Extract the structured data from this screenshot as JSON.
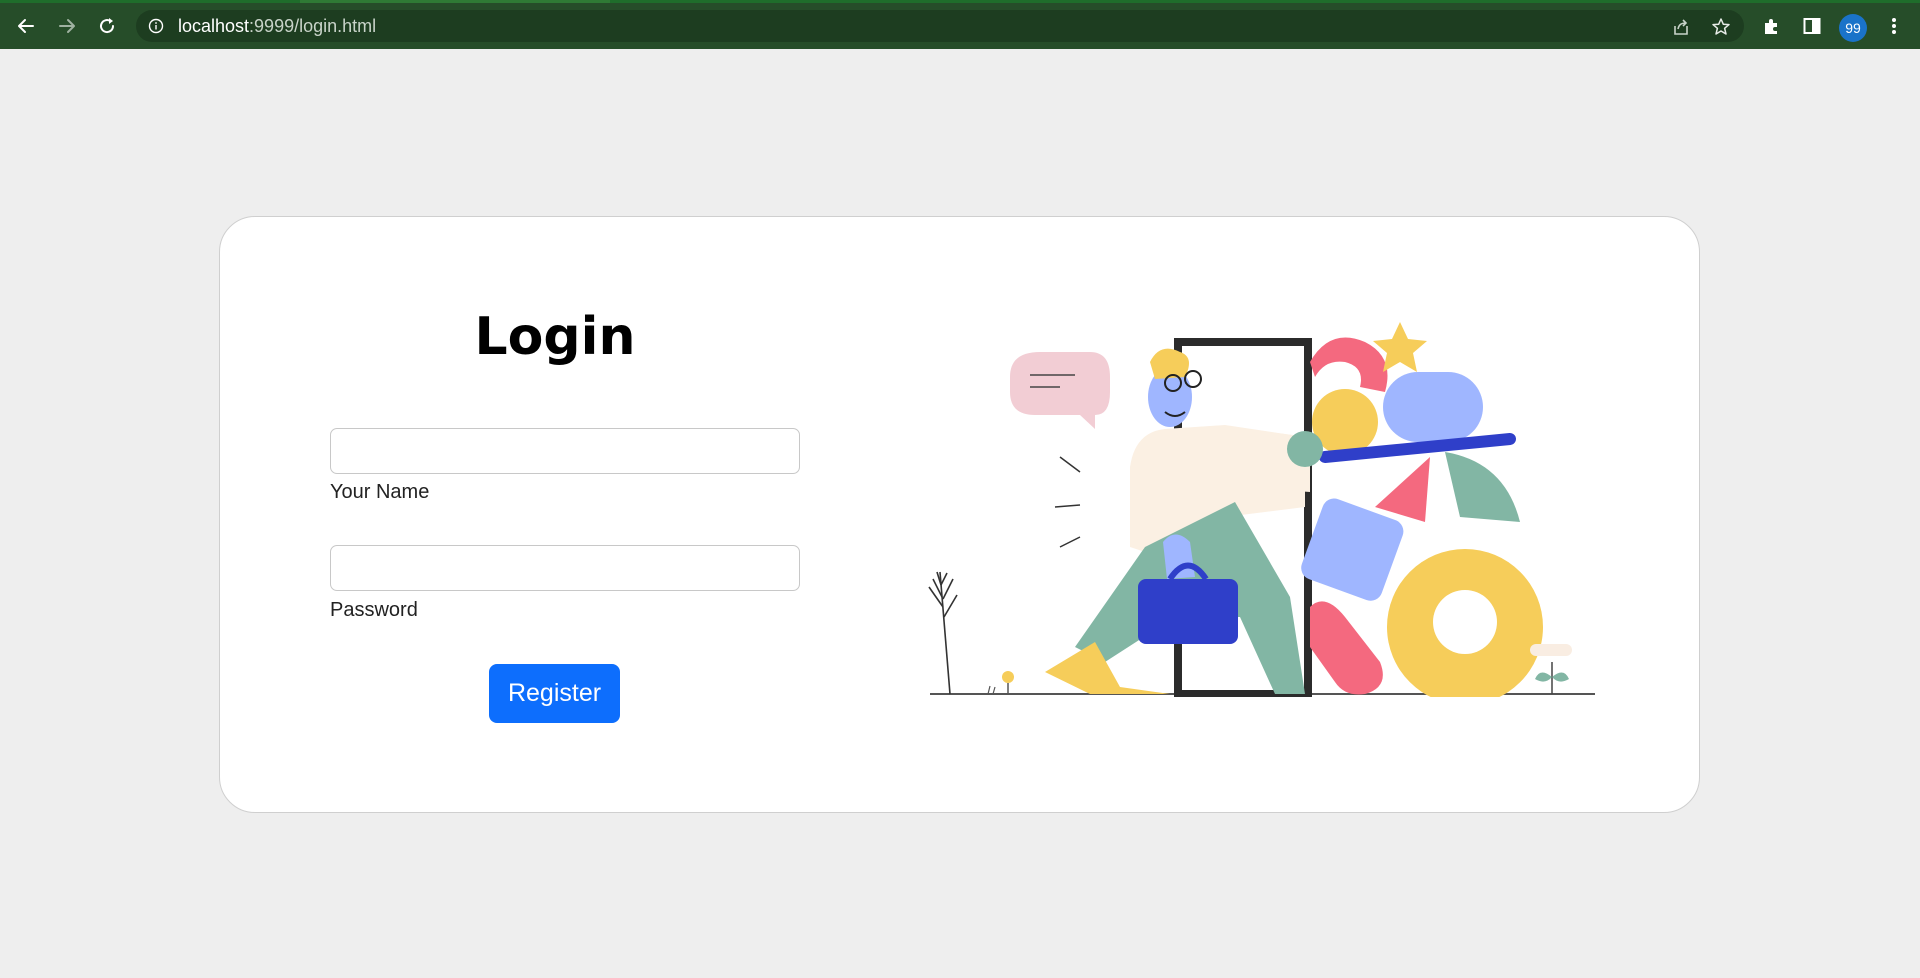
{
  "browser": {
    "url_host": "localhost",
    "url_rest": ":9999/login.html",
    "profile_badge": "99",
    "icons": [
      "back-icon",
      "forward-icon",
      "reload-icon",
      "info-icon",
      "share-icon",
      "star-icon",
      "extensions-icon",
      "side-panel-icon",
      "menu-icon"
    ]
  },
  "login": {
    "title": "Login",
    "name_label": "Your Name",
    "name_value": "",
    "password_label": "Password",
    "password_value": "",
    "register_label": "Register"
  },
  "colors": {
    "chrome_bg": "#264d29",
    "page_bg": "#eeeeee",
    "button": "#0d6efd"
  }
}
